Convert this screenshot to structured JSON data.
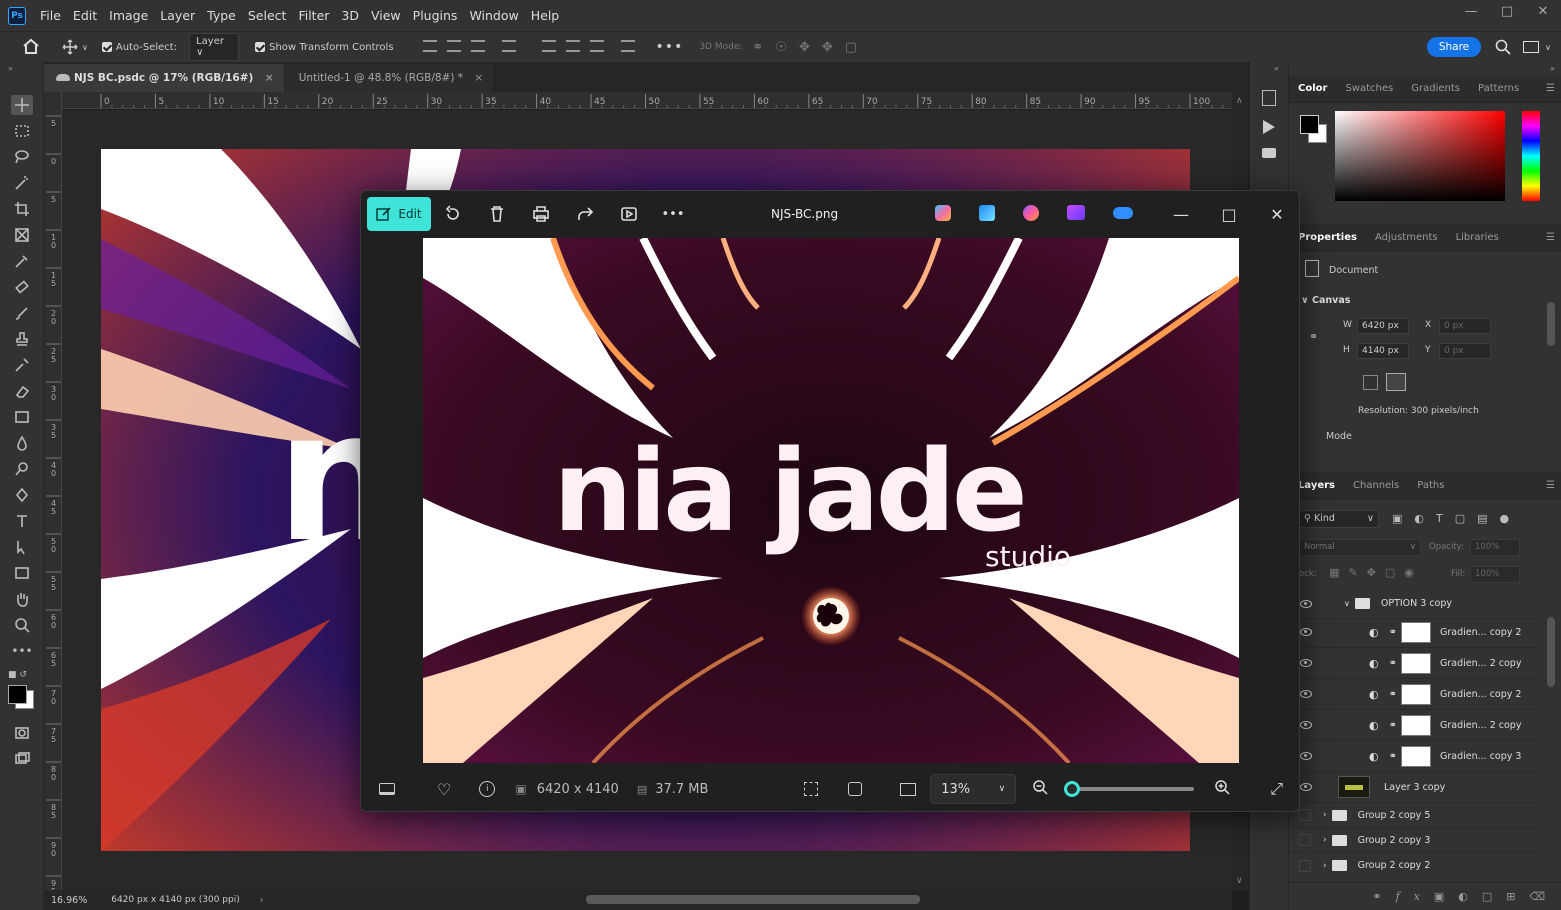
{
  "app": {
    "logo": "Ps"
  },
  "menu": [
    "File",
    "Edit",
    "Image",
    "Layer",
    "Type",
    "Select",
    "Filter",
    "3D",
    "View",
    "Plugins",
    "Window",
    "Help"
  ],
  "options": {
    "auto_select_label": "Auto-Select:",
    "auto_select_value": "Layer",
    "transform_label": "Show Transform Controls",
    "mode3d_label": "3D Mode:",
    "share_label": "Share"
  },
  "tabs": [
    {
      "label": "NJS BC.psdc @ 17% (RGB/16#)"
    },
    {
      "label": "Untitled-1 @ 48.8% (RGB/8#) *"
    }
  ],
  "ruler_top": [
    "0",
    "5",
    "10",
    "15",
    "20",
    "25",
    "30",
    "35",
    "40",
    "45",
    "50",
    "55",
    "60",
    "65",
    "70",
    "75",
    "80",
    "85",
    "90",
    "95",
    "100"
  ],
  "ruler_left": [
    "5",
    "0",
    "5",
    "1\n0",
    "1\n5",
    "2\n0",
    "2\n5",
    "3\n0",
    "3\n5",
    "4\n0",
    "4\n5",
    "5\n0",
    "5\n5",
    "6\n0",
    "6\n5",
    "7\n0",
    "7\n5",
    "8\n0",
    "8\n5",
    "9\n0",
    "9\n5",
    "0"
  ],
  "status": {
    "zoom": "16.96%",
    "doc_info": "6420 px x 4140 px (300 ppi)"
  },
  "color_panel": {
    "tabs": [
      "Color",
      "Swatches",
      "Gradients",
      "Patterns"
    ],
    "active": "Color",
    "foreground": "#000000",
    "background": "#ffffff",
    "hue": "#ff0000"
  },
  "properties_panel": {
    "tabs": [
      "Properties",
      "Adjustments",
      "Libraries"
    ],
    "doc_label": "Document",
    "section": "Canvas",
    "w_label": "W",
    "w_value": "6420 px",
    "h_label": "H",
    "h_value": "4140 px",
    "x_label": "X",
    "x_value": "0 px",
    "y_label": "Y",
    "y_value": "0 px",
    "resolution": "Resolution: 300 pixels/inch",
    "mode_label": "Mode"
  },
  "layers_panel": {
    "tabs": [
      "Layers",
      "Channels",
      "Paths"
    ],
    "kind_label": "Kind",
    "blend_mode": "Normal",
    "opacity_label": "Opacity:",
    "opacity_value": "100%",
    "lock_label": "ock:",
    "fill_label": "Fill:",
    "fill_value": "100%",
    "layers": [
      {
        "name": "OPTION 3 copy",
        "type": "group-open",
        "visible": true
      },
      {
        "name": "Gradien... copy 2",
        "type": "fill",
        "visible": true
      },
      {
        "name": "Gradien... 2 copy",
        "type": "fill",
        "visible": true
      },
      {
        "name": "Gradien... copy 2",
        "type": "fill",
        "visible": true
      },
      {
        "name": "Gradien... 2 copy",
        "type": "fill",
        "visible": true
      },
      {
        "name": "Gradien... copy 3",
        "type": "fill",
        "visible": true
      },
      {
        "name": "Layer 3 copy",
        "type": "image",
        "visible": true
      },
      {
        "name": "Group 2 copy 5",
        "type": "group",
        "visible": false
      },
      {
        "name": "Group 2 copy 3",
        "type": "group",
        "visible": false
      },
      {
        "name": "Group 2 copy 2",
        "type": "group",
        "visible": false
      }
    ]
  },
  "photos_window": {
    "edit_label": "Edit",
    "title": "NJS-BC.png",
    "dimensions": "6420 x 4140",
    "filesize": "37.7 MB",
    "zoom": "13%",
    "zoom_level": 0.0
  },
  "artwork": {
    "brand": "nia jade",
    "sub": "studio"
  }
}
